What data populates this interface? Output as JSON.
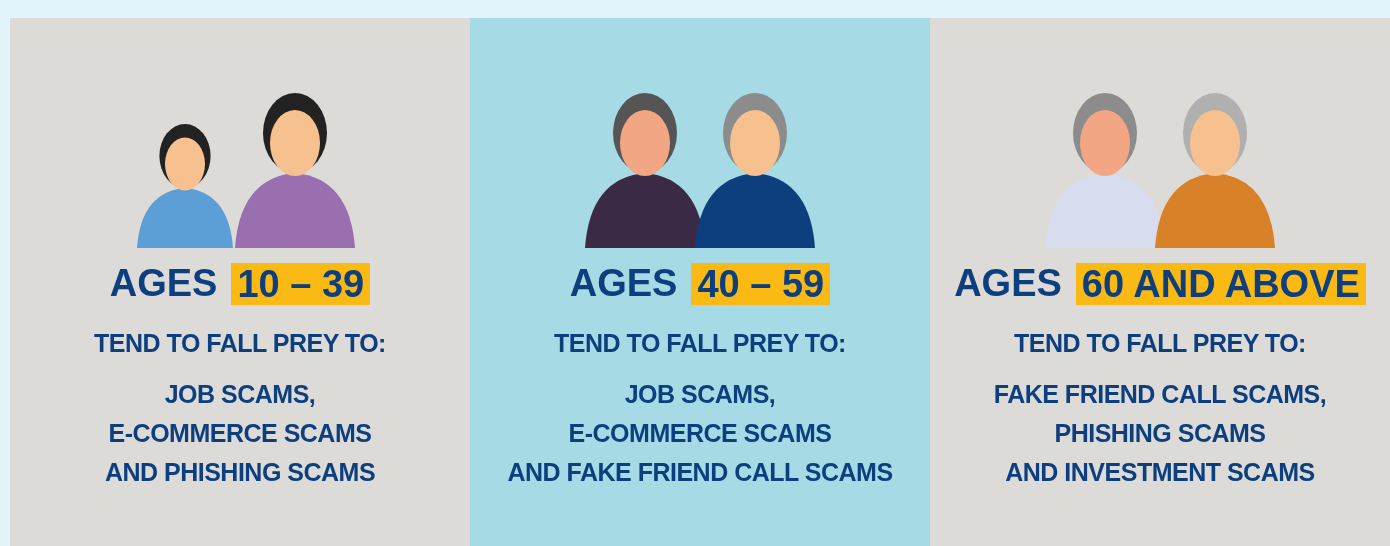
{
  "columns": [
    {
      "highlighted": false,
      "age_label": "AGES",
      "age_range": "10 – 39",
      "subtitle": "TEND TO FALL PREY TO:",
      "scams": [
        "JOB SCAMS,",
        "E-COMMERCE SCAMS",
        "AND PHISHING SCAMS"
      ]
    },
    {
      "highlighted": true,
      "age_label": "AGES",
      "age_range": "40 – 59",
      "subtitle": "TEND TO FALL PREY TO:",
      "scams": [
        "JOB SCAMS,",
        "E-COMMERCE SCAMS",
        "AND FAKE FRIEND CALL SCAMS"
      ]
    },
    {
      "highlighted": false,
      "age_label": "AGES",
      "age_range": "60 AND ABOVE",
      "subtitle": "TEND TO FALL PREY TO:",
      "scams": [
        "FAKE FRIEND CALL SCAMS,",
        "PHISHING SCAMS",
        "AND INVESTMENT SCAMS"
      ]
    }
  ]
}
